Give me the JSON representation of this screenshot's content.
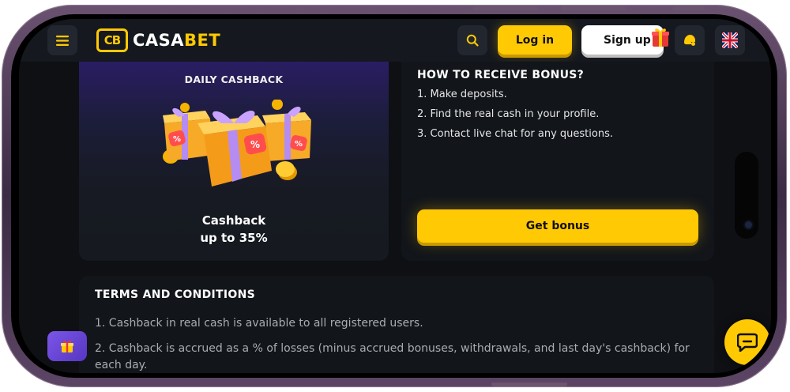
{
  "header": {
    "brand_prefix": "CASA",
    "brand_suffix": "BET",
    "logo_mark": "CB",
    "login_label": "Log in",
    "signup_label": "Sign up",
    "icons": [
      "menu-icon",
      "search-icon",
      "gift-icon",
      "support-icon",
      "uk-flag-icon"
    ]
  },
  "promo": {
    "title": "DAILY CASHBACK",
    "subtitle_line1": "Cashback",
    "subtitle_line2": "up to 35%"
  },
  "bonus": {
    "heading": "HOW TO RECEIVE BONUS?",
    "steps": [
      "1. Make deposits.",
      "2. Find the real cash in your profile.",
      "3. Contact live chat for any questions."
    ],
    "button_label": "Get bonus"
  },
  "terms": {
    "heading": "TERMS AND CONDITIONS",
    "items": [
      "1. Cashback in real cash is available to all registered users.",
      "2. Cashback is accrued as a % of losses (minus accrued bonuses, withdrawals, and last day's cashback) for each day."
    ]
  },
  "colors": {
    "accent": "#ffc904",
    "background": "#0e1014",
    "panel": "#12151a",
    "gift_fab": "#6a46d8"
  }
}
